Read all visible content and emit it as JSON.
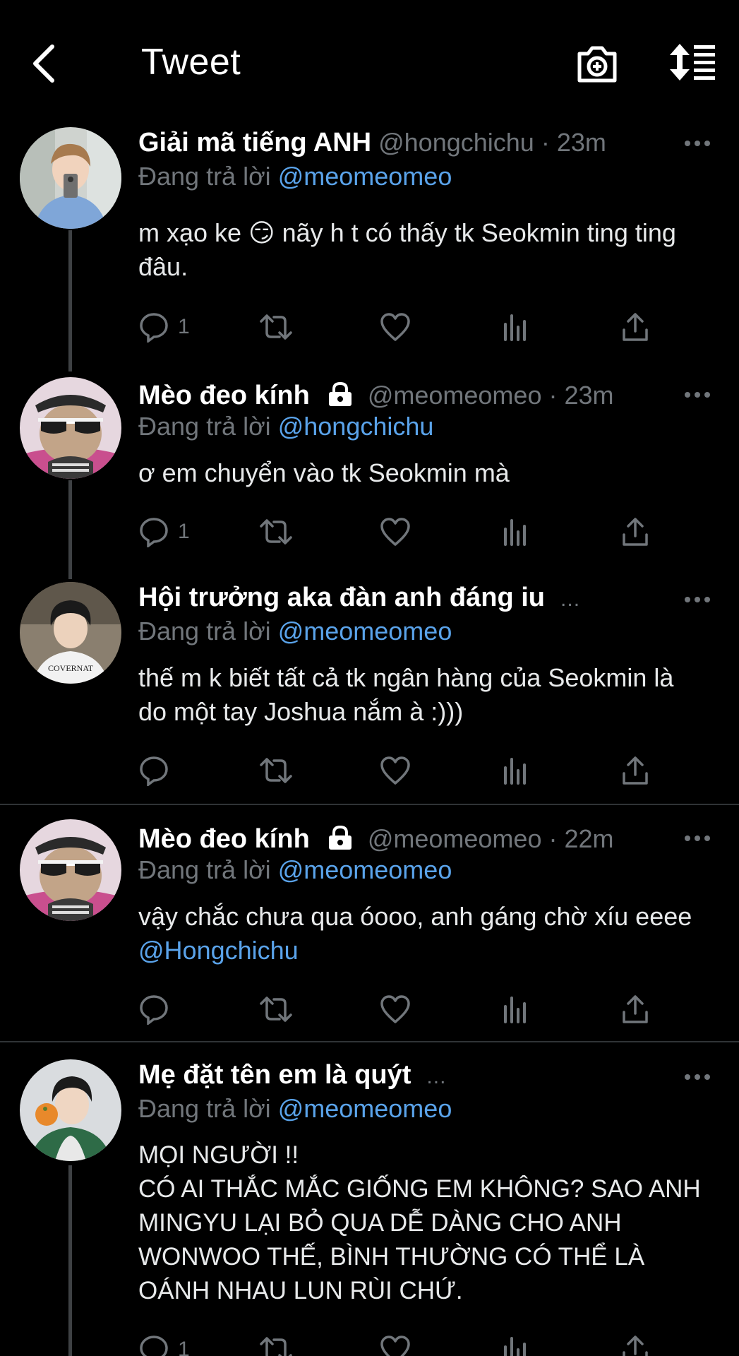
{
  "header": {
    "title": "Tweet",
    "back_icon": "chevron-left-icon",
    "camera_icon": "camera-plus-icon",
    "sort_icon": "sort-list-icon"
  },
  "colors": {
    "background": "#000000",
    "text": "#e7e9ea",
    "secondary": "#71767b",
    "link": "#5aa3ea",
    "divider": "#2f3336"
  },
  "tweets": [
    {
      "name": "Giải mã tiếng ANH",
      "handle": "@hongchichu",
      "dot": "·",
      "time": "23m",
      "reply_prefix": "Đang trả lời",
      "reply_to": "@meomeomeo",
      "text_before": "m xạo ke 😏  nãy h t có thấy tk Seokmin ting ting đâu.",
      "reply_count": "1"
    },
    {
      "name": "Mèo đeo kính",
      "handle": "@meomeomeo",
      "dot": "·",
      "time": "23m",
      "reply_prefix": "Đang trả lời",
      "reply_to": "@hongchichu",
      "text_before": "ơ em chuyển vào tk Seokmin mà",
      "reply_count": "1"
    },
    {
      "name": "Hội trưởng aka đàn anh đáng iu",
      "truncation": "...",
      "reply_prefix": "Đang trả lời",
      "reply_to": "@meomeomeo",
      "text_before": "thế m k biết tất cả tk ngân hàng của Seokmin là do một tay Joshua nắm à :)))"
    },
    {
      "name": "Mèo đeo kính",
      "handle": "@meomeomeo",
      "dot": "·",
      "time": "22m",
      "reply_prefix": "Đang trả lời",
      "reply_to": "@meomeomeo",
      "text_before": "vậy chắc chưa qua óooo, anh gáng chờ xíu eeee ",
      "text_mention": "@Hongchichu"
    },
    {
      "name": "Mẹ đặt tên em là quýt",
      "truncation": "...",
      "reply_prefix": "Đang trả lời",
      "reply_to": "@meomeomeo",
      "text_before": "MỌI NGƯỜI !!\nCÓ AI THẮC MẮC GIỐNG EM KHÔNG? SAO ANH MINGYU LẠI BỎ QUA DỄ DÀNG CHO ANH WONWOO THẾ, BÌNH THƯỜNG CÓ THỂ LÀ OÁNH NHAU LUN RÙI CHỨ.",
      "reply_count": "1"
    }
  ]
}
